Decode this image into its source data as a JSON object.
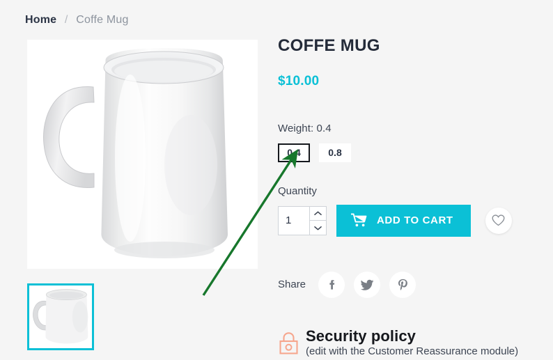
{
  "breadcrumb": {
    "home": "Home",
    "separator": "/",
    "current": "Coffe Mug"
  },
  "product": {
    "title": "COFFE MUG",
    "price": "$10.00"
  },
  "attribute": {
    "label": "Weight: 0.4",
    "options": [
      {
        "value": "0.4",
        "selected": true
      },
      {
        "value": "0.8",
        "selected": false
      }
    ]
  },
  "quantity": {
    "label": "Quantity",
    "value": "1"
  },
  "cart": {
    "add_label": "ADD TO CART",
    "icon": "shopping-cart-icon"
  },
  "wishlist": {
    "icon": "heart-icon"
  },
  "share": {
    "label": "Share",
    "networks": [
      {
        "name": "facebook",
        "glyph": "f"
      },
      {
        "name": "twitter",
        "glyph": "twitter-bird"
      },
      {
        "name": "pinterest",
        "glyph": "pinterest-p"
      }
    ]
  },
  "policy": {
    "icon": "lock-icon",
    "title": "Security policy",
    "subtitle": "(edit with the Customer Reassurance module)"
  },
  "gallery": {
    "main_alt": "white-coffee-mug",
    "thumbnails": [
      {
        "alt": "white-coffee-mug-thumb",
        "active": true
      }
    ]
  },
  "colors": {
    "accent": "#0bc0d6",
    "background": "#f5f5f5",
    "title": "#242b39",
    "policy_icon": "#f6a68d",
    "annotation_arrow": "#17772c"
  }
}
